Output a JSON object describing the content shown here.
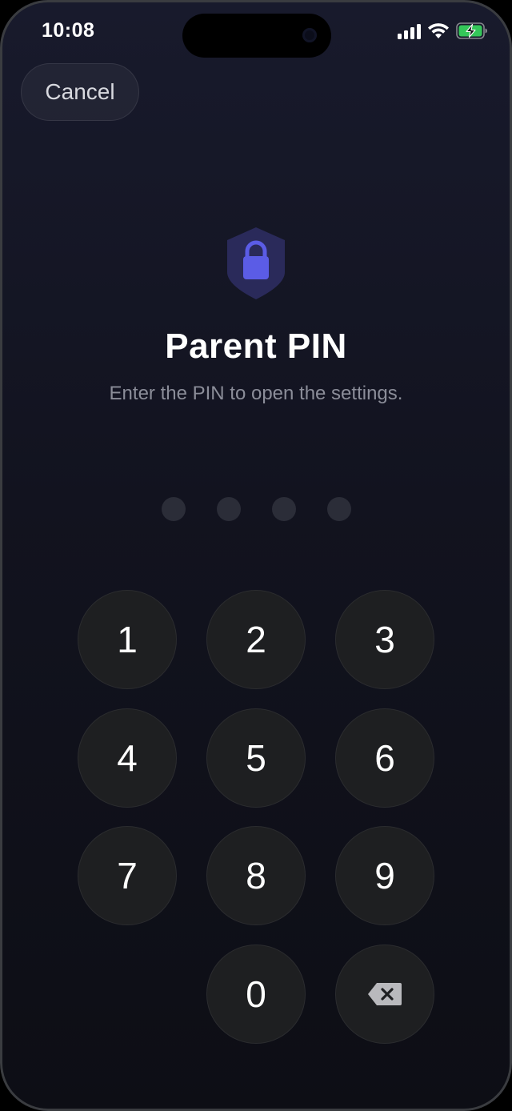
{
  "status_bar": {
    "time": "10:08",
    "signal_icon": "cellular-signal-icon",
    "wifi_icon": "wifi-icon",
    "battery_icon": "battery-charging-icon",
    "battery_color": "#34c759"
  },
  "header": {
    "cancel_label": "Cancel"
  },
  "main": {
    "icon": "shield-lock-icon",
    "accent_color": "#5b5ce6",
    "title": "Parent PIN",
    "subtitle": "Enter the PIN to open the settings.",
    "pin_length": 4,
    "pin_entered": 0
  },
  "keypad": {
    "keys": [
      "1",
      "2",
      "3",
      "4",
      "5",
      "6",
      "7",
      "8",
      "9",
      "0"
    ],
    "delete_icon": "backspace-icon"
  }
}
